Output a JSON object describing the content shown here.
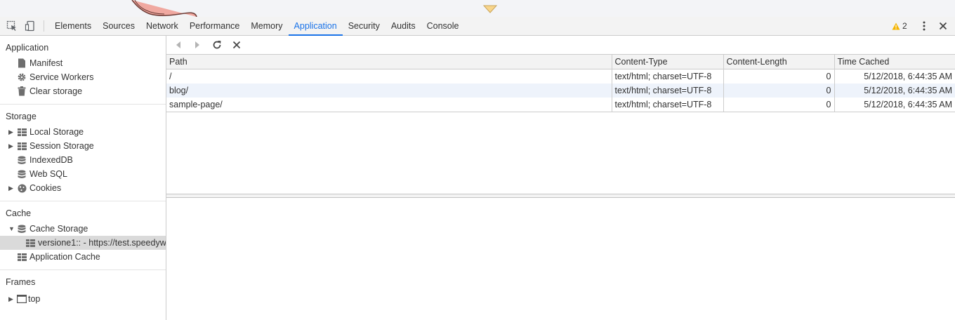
{
  "tabbar": {
    "tabs": [
      "Elements",
      "Sources",
      "Network",
      "Performance",
      "Memory",
      "Application",
      "Security",
      "Audits",
      "Console"
    ],
    "active_tab": "Application",
    "warning_count": "2"
  },
  "sidebar": {
    "application": {
      "title": "Application",
      "items": [
        "Manifest",
        "Service Workers",
        "Clear storage"
      ]
    },
    "storage": {
      "title": "Storage",
      "items": [
        "Local Storage",
        "Session Storage",
        "IndexedDB",
        "Web SQL",
        "Cookies"
      ]
    },
    "cache": {
      "title": "Cache",
      "items": [
        "Cache Storage",
        "versione1:: - https://test.speedyw",
        "Application Cache"
      ]
    },
    "frames": {
      "title": "Frames",
      "items": [
        "top"
      ]
    }
  },
  "table": {
    "columns": [
      "Path",
      "Content-Type",
      "Content-Length",
      "Time Cached"
    ],
    "rows": [
      {
        "path": "/",
        "content_type": "text/html; charset=UTF-8",
        "content_length": "0",
        "time_cached": "5/12/2018, 6:44:35 AM"
      },
      {
        "path": "blog/",
        "content_type": "text/html; charset=UTF-8",
        "content_length": "0",
        "time_cached": "5/12/2018, 6:44:35 AM"
      },
      {
        "path": "sample-page/",
        "content_type": "text/html; charset=UTF-8",
        "content_length": "0",
        "time_cached": "5/12/2018, 6:44:35 AM"
      }
    ]
  },
  "colors": {
    "accent": "#1a73e8",
    "warning": "#f4b400",
    "selected_row": "#dadada",
    "alt_row": "#eef3fb"
  },
  "icons": [
    "inspect-icon",
    "device-toolbar-icon",
    "warning-icon",
    "kebab-menu-icon",
    "close-icon",
    "manifest-icon",
    "gear-icon",
    "trash-icon",
    "grid-icon",
    "database-icon",
    "cookie-icon",
    "frame-icon",
    "back-icon",
    "forward-icon",
    "refresh-icon",
    "delete-icon"
  ]
}
